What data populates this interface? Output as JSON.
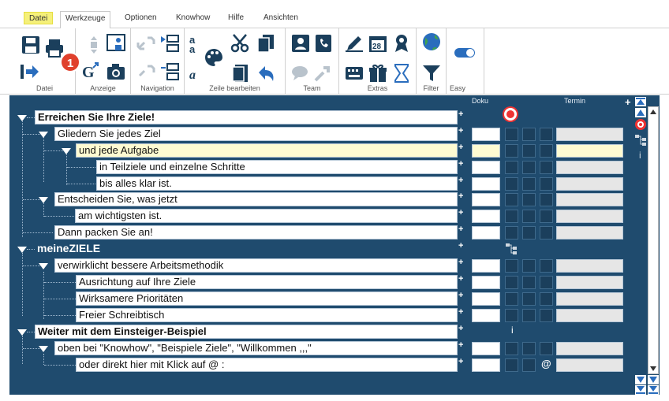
{
  "tabs": [
    "Datei",
    "Werkzeuge",
    "Optionen",
    "Knowhow",
    "Hilfe",
    "Ansichten"
  ],
  "badge": "1",
  "groups": [
    "Datei",
    "Anzeige",
    "Navigation",
    "Zeile bearbeiten",
    "Team",
    "Extras",
    "Filter",
    "Easy"
  ],
  "headers": {
    "doku": "Doku",
    "termin": "Termin"
  },
  "rows": [
    "Erreichen Sie Ihre Ziele!",
    "Gliedern Sie jedes Ziel",
    "und jede Aufgabe",
    "in Teilziele und einzelne Schritte",
    "bis alles klar ist.",
    "Entscheiden Sie, was jetzt",
    "am wichtigsten ist.",
    "Dann packen Sie an!",
    "meineZIELE",
    "verwirklicht bessere Arbeitsmethodik",
    "Ausrichtung auf Ihre Ziele",
    "Wirksamere Prioritäten",
    "Freier Schreibtisch",
    "Weiter mit dem Einsteiger-Beispiel",
    "oben bei \"Knowhow\", \"Beispiele Ziele\", \"Willkommen ,,,\"",
    "oder direkt hier mit Klick auf @ :"
  ],
  "plus": "+",
  "at": "@",
  "info": "i",
  "colors": {
    "outline_bg": "#1f4b6e",
    "highlight": "#fefbd2",
    "file_tab": "#f5f07a",
    "badge": "#e0412d"
  }
}
